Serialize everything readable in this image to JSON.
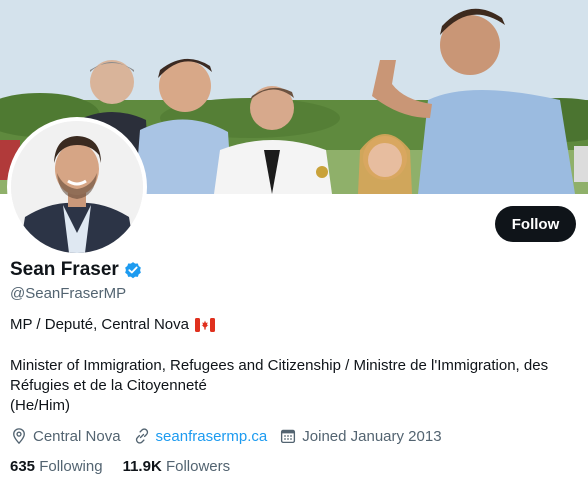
{
  "profile": {
    "display_name": "Sean Fraser",
    "handle": "@SeanFraserMP",
    "verified": true,
    "bio": {
      "line1": "MP / Deputé, Central Nova",
      "line2": "Minister of Immigration,  Refugees and Citizenship / Ministre de l'Immigration, des",
      "line3": "Réfugies et de la Citoyenneté",
      "line4": "(He/Him)"
    },
    "location": "Central Nova",
    "website": "seanfrasermp.ca",
    "joined": "Joined January 2013"
  },
  "actions": {
    "follow_label": "Follow"
  },
  "stats": {
    "following_count": "635",
    "following_label": "Following",
    "followers_count": "11.9K",
    "followers_label": "Followers"
  },
  "icons": {
    "verified": "verified-badge-icon",
    "flag": "canada-flag-icon",
    "location": "location-pin-icon",
    "link": "link-icon",
    "calendar": "calendar-icon"
  },
  "colors": {
    "accent": "#1d9bf0",
    "text_primary": "#0f1419",
    "text_secondary": "#536471",
    "button_bg": "#0f1419"
  }
}
